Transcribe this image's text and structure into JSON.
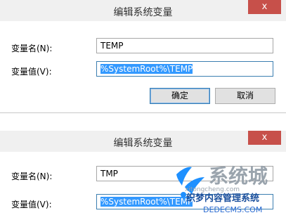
{
  "dialogs": [
    {
      "title": "编辑系统变量",
      "close_glyph": "x",
      "name_label": "变量名(N):",
      "name_value": "TEMP",
      "value_label": "变量值(V):",
      "value_value": "%SystemRoot%\\TEMP",
      "ok_label": "确定",
      "cancel_label": "取消"
    },
    {
      "title": "编辑系统变量",
      "close_glyph": "x",
      "name_label": "变量名(N):",
      "name_value": "TMP",
      "value_label": "变量值(V):",
      "value_value": "%SystemRoot%\\TEMP"
    }
  ],
  "watermark": {
    "brand_text": "系统城",
    "url_text": "xitongcheng.com",
    "cms_text": "织梦内容管理系统",
    "domain_text": "DEDECMS.COM"
  }
}
